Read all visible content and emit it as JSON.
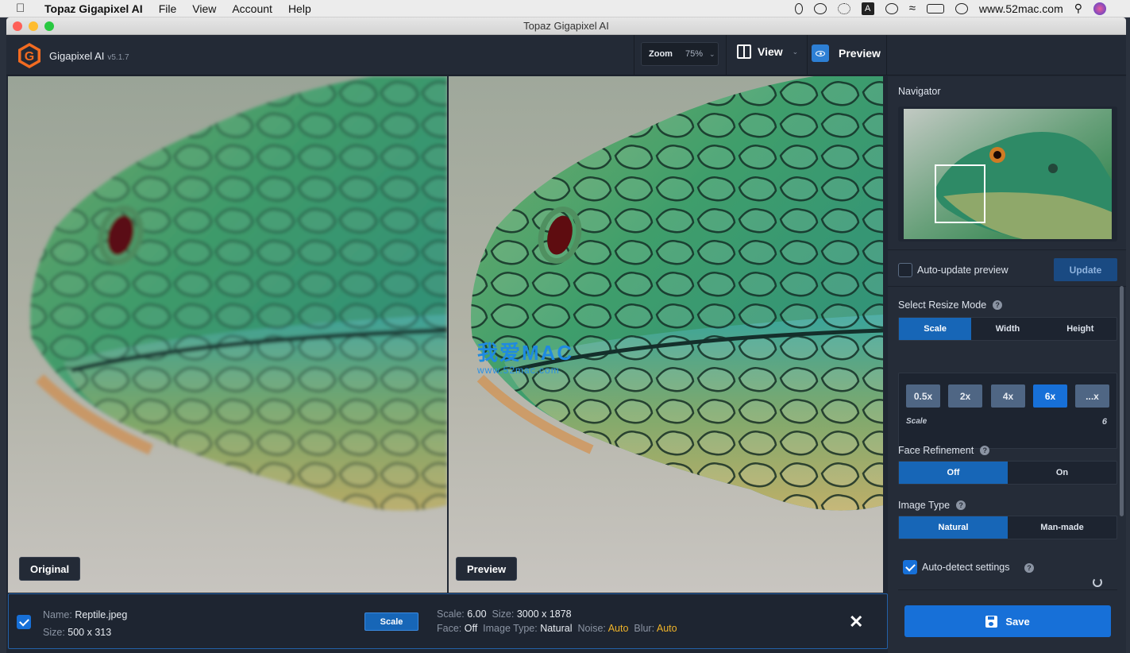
{
  "menubar": {
    "app_name": "Topaz Gigapixel AI",
    "items": [
      "File",
      "View",
      "Account",
      "Help"
    ],
    "site": "www.52mac.com",
    "tray_letter": "A"
  },
  "window": {
    "title": "Topaz Gigapixel AI"
  },
  "toolbar": {
    "logo_letter": "G",
    "brand": "Gigapixel AI",
    "version": "v5.1.7",
    "zoom_label": "Zoom",
    "zoom_value": "75%",
    "view_label": "View",
    "preview_label": "Preview"
  },
  "canvas": {
    "left_label": "Original",
    "right_label": "Preview",
    "watermark_big": "我爱MAC",
    "watermark_small": "www.52mac.com"
  },
  "sidebar": {
    "navigator_title": "Navigator",
    "auto_update_label": "Auto-update preview",
    "update_label": "Update",
    "resize_mode_title": "Select Resize Mode",
    "resize_modes": [
      "Scale",
      "Width",
      "Height"
    ],
    "scale_chips": [
      "0.5x",
      "2x",
      "4x",
      "6x",
      "...x"
    ],
    "scale_label": "Scale",
    "scale_value": "6",
    "face_title": "Face Refinement",
    "face_options": [
      "Off",
      "On"
    ],
    "image_type_title": "Image Type",
    "image_type_options": [
      "Natural",
      "Man-made"
    ],
    "auto_detect_label": "Auto-detect settings",
    "save_label": "Save"
  },
  "file_info": {
    "name_label": "Name:",
    "name_value": "Reptile.jpeg",
    "size_label": "Size:",
    "size_value": "500 x 313",
    "scale_chip": "Scale",
    "out_scale_label": "Scale:",
    "out_scale_value": "6.00",
    "out_size_label": "Size:",
    "out_size_value": "3000 x 1878",
    "face_label": "Face:",
    "face_value": "Off",
    "image_type_label": "Image Type:",
    "image_type_value": "Natural",
    "noise_label": "Noise:",
    "noise_value": "Auto",
    "blur_label": "Blur:",
    "blur_value": "Auto",
    "close_glyph": "✕"
  }
}
